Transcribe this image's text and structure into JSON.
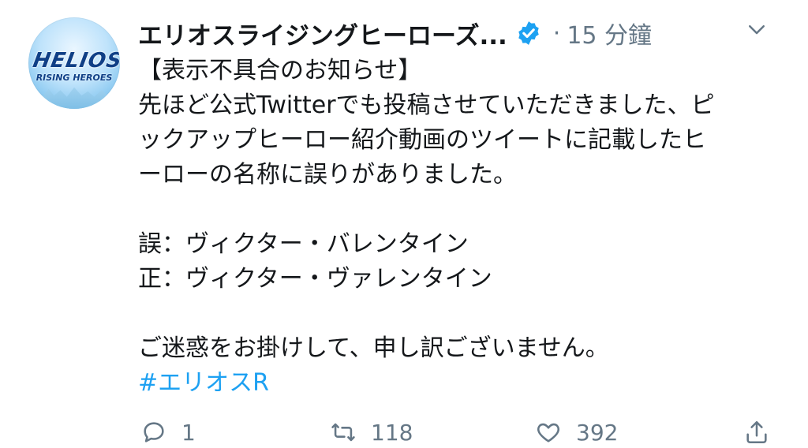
{
  "avatar": {
    "logo_main": "HELIOS",
    "logo_sub": "RISING HEROES"
  },
  "header": {
    "display_name": "エリオスライジングヒーローズ...",
    "separator": "·",
    "time": "15 分鐘"
  },
  "tweet": {
    "lines": [
      "【表示不具合のお知らせ】",
      "先ほど公式Twitterでも投稿させていただきました、ピ",
      "ックアップヒーロー紹介動画のツイートに記載したヒ",
      "ーローの名称に誤りがありました。",
      "",
      "誤：ヴィクター・バレンタイン",
      "正：ヴィクター・ヴァレンタイン",
      "",
      "ご迷惑をお掛けして、申し訳ございません。"
    ],
    "hashtag": "#エリオスR"
  },
  "actions": {
    "reply_count": "1",
    "retweet_count": "118",
    "like_count": "392"
  },
  "colors": {
    "accent": "#1da1f2",
    "muted": "#657786",
    "text": "#14171a"
  },
  "icons": [
    "verified-badge-icon",
    "chevron-down-icon",
    "reply-icon",
    "retweet-icon",
    "like-icon",
    "share-icon"
  ]
}
